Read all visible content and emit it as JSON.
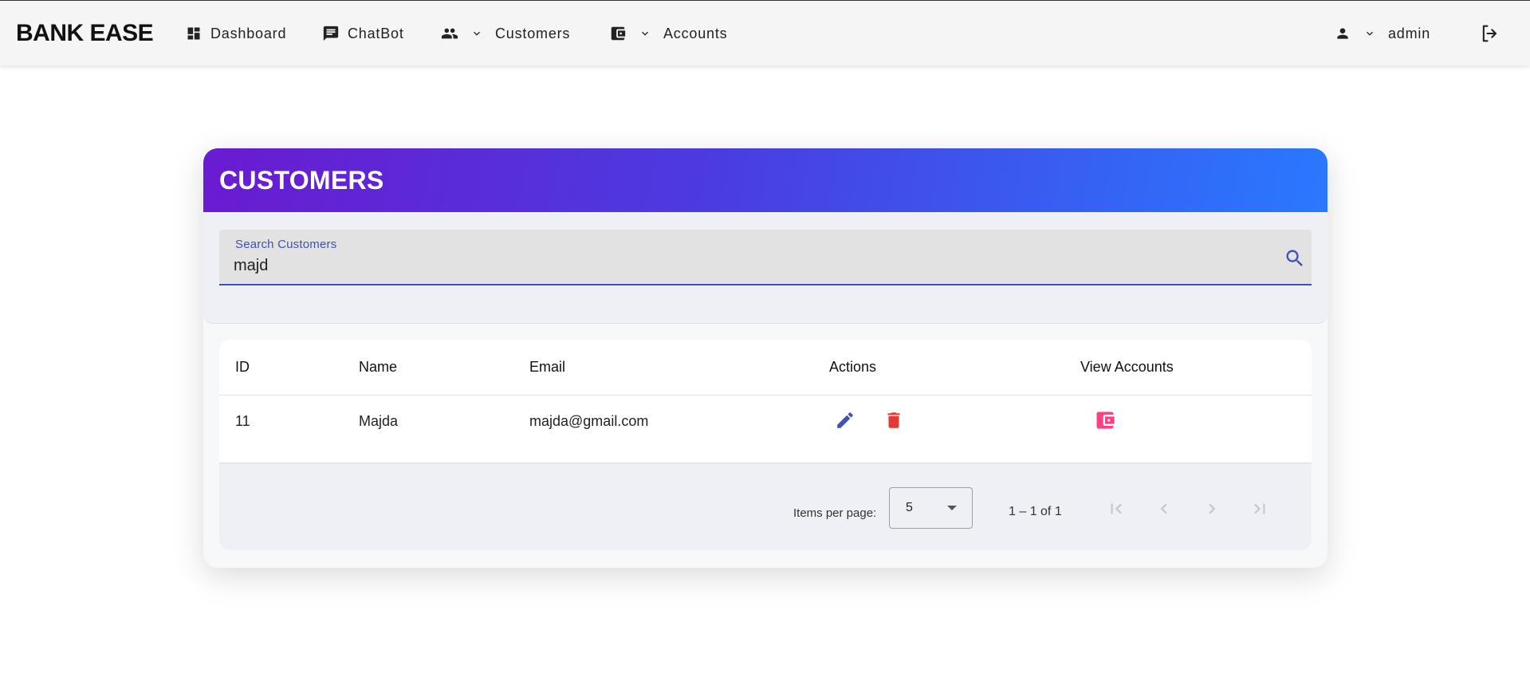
{
  "header": {
    "brand": "BANK EASE",
    "nav": {
      "dashboard": "Dashboard",
      "chatbot": "ChatBot",
      "customers": "Customers",
      "accounts": "Accounts"
    },
    "user": "admin",
    "icons": {
      "dashboard": "dashboard-icon",
      "chatbot": "chat-icon",
      "customers": "people-icon",
      "accounts": "wallet-icon",
      "user": "person-icon",
      "logout": "logout-icon"
    }
  },
  "card": {
    "title": "CUSTOMERS",
    "gradient": [
      "#6a1bd1",
      "#2979ff"
    ]
  },
  "search": {
    "label": "Search Customers",
    "value": "majd",
    "accent": "#3f51b5"
  },
  "table": {
    "columns": [
      "ID",
      "Name",
      "Email",
      "Actions",
      "View Accounts"
    ],
    "rows": [
      {
        "id": "11",
        "name": "Majda",
        "email": "majda@gmail.com"
      }
    ],
    "colors": {
      "edit": "#3f51b5",
      "delete": "#e53935",
      "accounts": "#ff4081"
    }
  },
  "paginator": {
    "items_label": "Items per page:",
    "page_size": "5",
    "range": "1 – 1 of 1"
  }
}
